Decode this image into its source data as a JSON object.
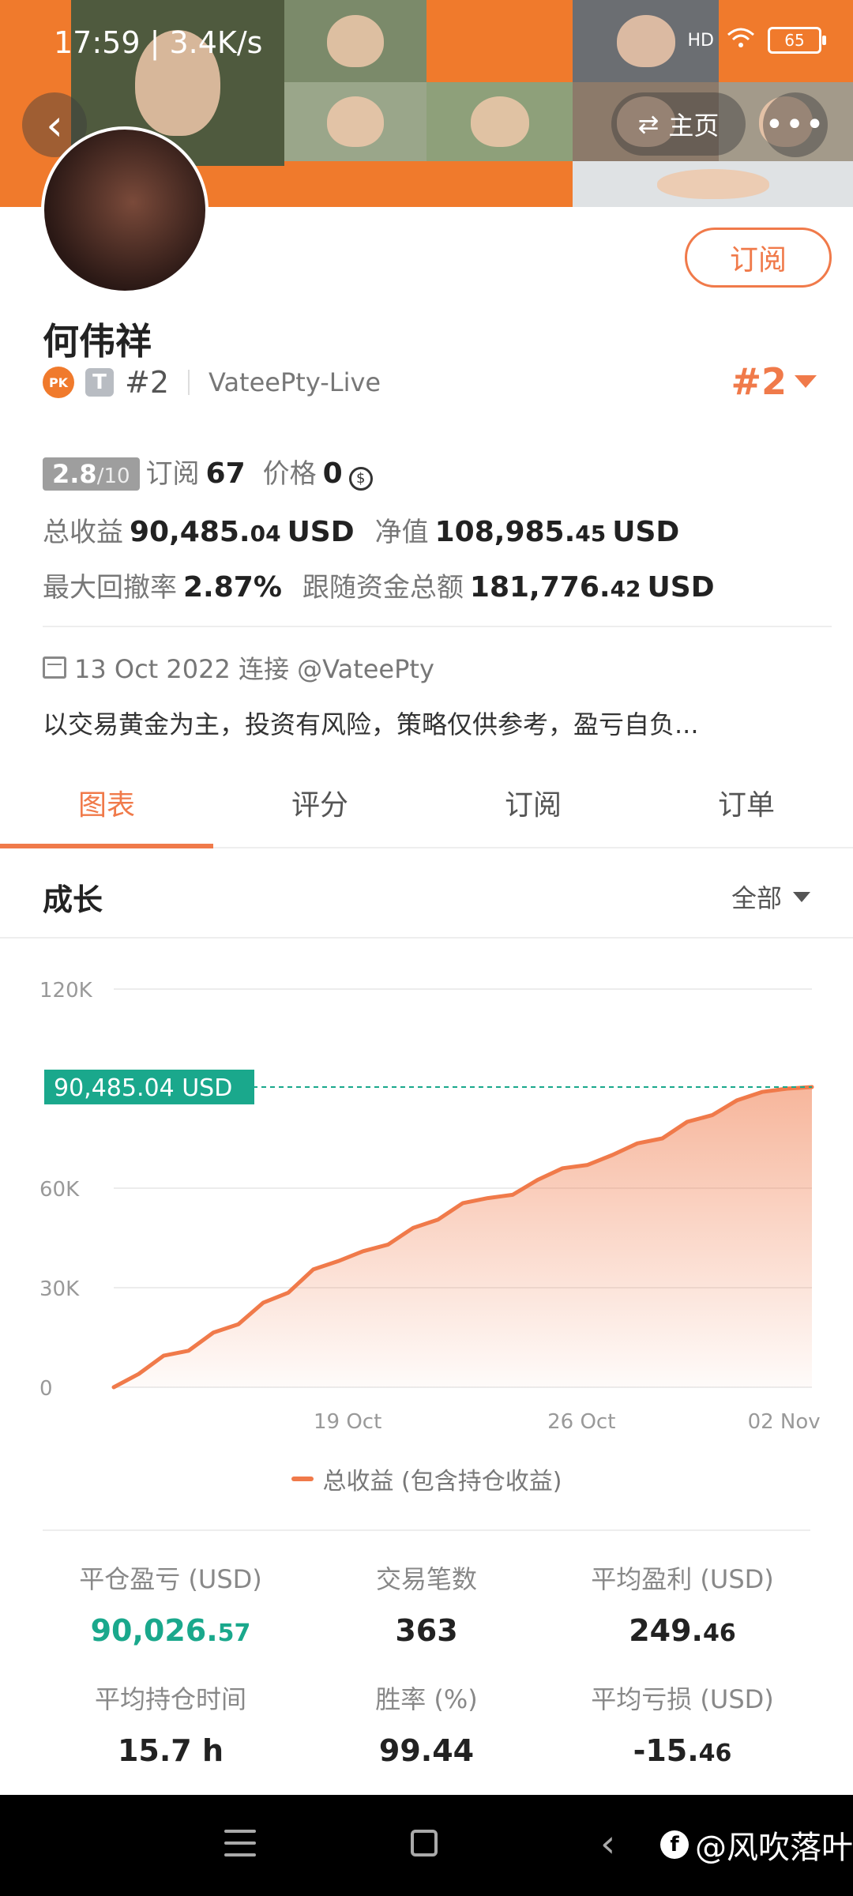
{
  "status_bar": {
    "time": "17:59 | 3.4K/s",
    "alarm_icon": "alarm-icon",
    "signal": "HD",
    "wifi_icon": "wifi-icon",
    "battery": "65"
  },
  "header": {
    "back_icon": "chevron-left-icon",
    "home_label": "主页",
    "home_icon": "switch-icon",
    "more_icon": "more-dots-icon"
  },
  "profile": {
    "name": "何伟祥",
    "subscribe_label": "订阅",
    "tier_badge": "T",
    "rank": "#2",
    "broker": "VateePty-Live",
    "rank_right": "#2",
    "score": "2.8",
    "score_denominator": "/10",
    "subscribe_count_label": "订阅",
    "subscribe_count": "67",
    "price_label": "价格",
    "price": "0",
    "total_profit_label": "总收益",
    "total_profit_main": "90,485.",
    "total_profit_dec": "04",
    "total_profit_unit": "USD",
    "net_value_label": "净值",
    "net_value_main": "108,985.",
    "net_value_dec": "45",
    "net_value_unit": "USD",
    "max_drawdown_label": "最大回撤率",
    "max_drawdown": "2.87%",
    "follow_funds_label": "跟随资金总额",
    "follow_funds_main": "181,776.",
    "follow_funds_dec": "42",
    "follow_funds_unit": "USD",
    "joined": "13 Oct 2022 连接 @VateePty",
    "description": "以交易黄金为主，投资有风险，策略仅供参考，盈亏自负..."
  },
  "tabs": [
    {
      "label": "图表",
      "active": true
    },
    {
      "label": "评分",
      "active": false
    },
    {
      "label": "订阅",
      "active": false
    },
    {
      "label": "订单",
      "active": false
    }
  ],
  "section": {
    "title": "成长",
    "filter": "全部"
  },
  "chart_data": {
    "type": "area",
    "y_ticks": [
      "0",
      "30K",
      "60K",
      "120K"
    ],
    "x_ticks": [
      "19 Oct",
      "26 Oct",
      "02 Nov"
    ],
    "ylim": [
      0,
      120000
    ],
    "current_label": "90,485.04 USD",
    "current_value": 90485.04,
    "legend": "总收益 (包含持仓收益)",
    "color": "#f07a4a",
    "series": [
      {
        "name": "总收益 (包含持仓收益)",
        "values": [
          0,
          4000,
          9500,
          11000,
          16500,
          19000,
          25500,
          28500,
          35500,
          38000,
          41000,
          43000,
          48000,
          50500,
          55500,
          57000,
          58000,
          62500,
          66000,
          67000,
          70000,
          73500,
          75000,
          80000,
          82000,
          86500,
          89000,
          90000,
          90485.04
        ]
      }
    ]
  },
  "metrics": [
    {
      "label": "平仓盈亏 (USD)",
      "main": "90,026.",
      "dec": "57",
      "teal": true
    },
    {
      "label": "交易笔数",
      "main": "363",
      "dec": "",
      "teal": false
    },
    {
      "label": "平均盈利 (USD)",
      "main": "249.",
      "dec": "46",
      "teal": false
    },
    {
      "label": "平均持仓时间",
      "main": "15.7 h",
      "dec": "",
      "teal": false
    },
    {
      "label": "胜率 (%)",
      "main": "99.44",
      "dec": "",
      "teal": false
    },
    {
      "label": "平均亏损 (USD)",
      "main": "-15.",
      "dec": "46",
      "teal": false
    }
  ],
  "navbar": {
    "menu_icon": "menu-icon",
    "home_icon": "square-icon",
    "back_icon": "chevron-left-icon",
    "watermark": "@风吹落叶"
  }
}
